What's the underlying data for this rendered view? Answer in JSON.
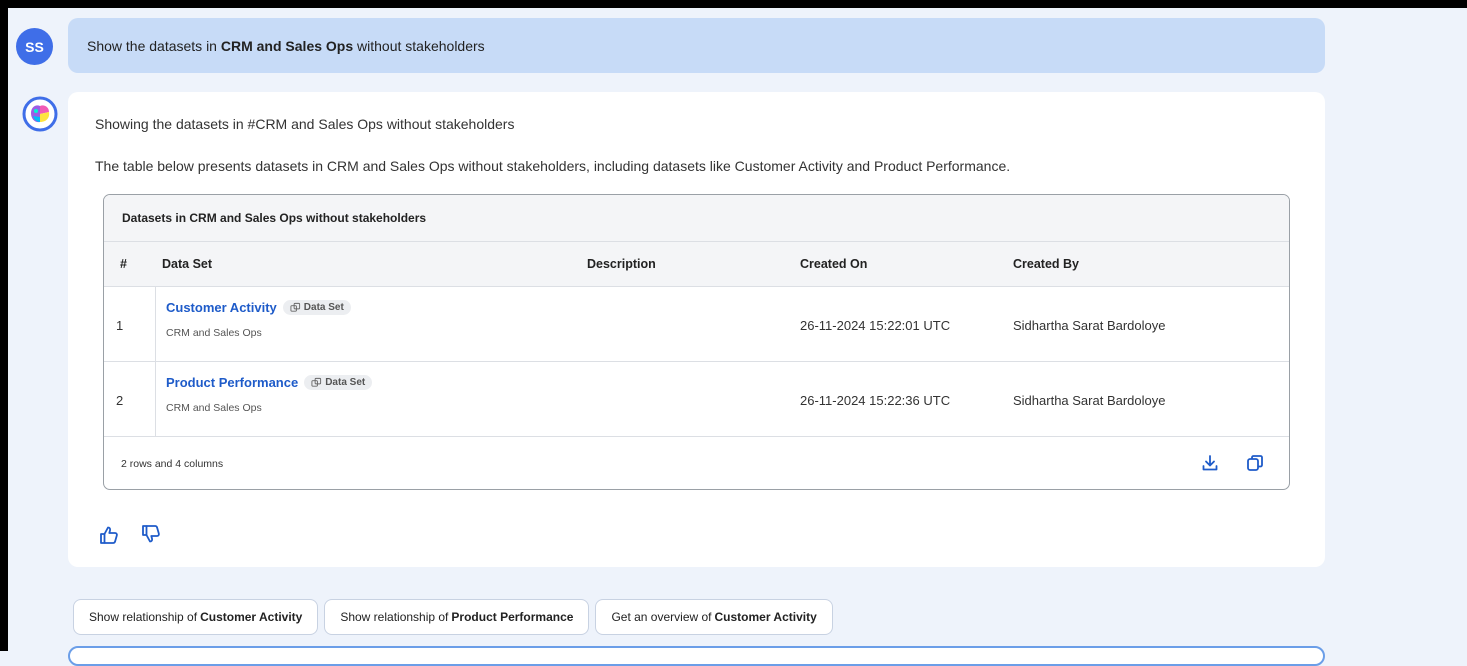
{
  "user": {
    "avatar_initials": "SS",
    "query_prefix": "Show the datasets in",
    "query_bold": "CRM and Sales Ops",
    "query_suffix": "without stakeholders"
  },
  "response": {
    "line1": "Showing the datasets in #CRM and Sales Ops without stakeholders",
    "line2": "The table below presents datasets in CRM and Sales Ops without stakeholders, including datasets like Customer Activity and Product Performance.",
    "table": {
      "title": "Datasets in CRM and Sales Ops without stakeholders",
      "headers": {
        "num": "#",
        "dataset": "Data Set",
        "description": "Description",
        "created_on": "Created On",
        "created_by": "Created By"
      },
      "rows": [
        {
          "num": "1",
          "name": "Customer Activity",
          "chip": "Data Set",
          "domain": "CRM and Sales Ops",
          "description": "",
          "created_on": "26-11-2024 15:22:01 UTC",
          "created_by": "Sidhartha Sarat Bardoloye"
        },
        {
          "num": "2",
          "name": "Product Performance",
          "chip": "Data Set",
          "domain": "CRM and Sales Ops",
          "description": "",
          "created_on": "26-11-2024 15:22:36 UTC",
          "created_by": "Sidhartha Sarat Bardoloye"
        }
      ],
      "summary": "2 rows and 4 columns"
    }
  },
  "suggestions": [
    {
      "prefix": "Show relationship of",
      "bold": "Customer Activity"
    },
    {
      "prefix": "Show relationship of",
      "bold": "Product Performance"
    },
    {
      "prefix": "Get an overview of",
      "bold": "Customer Activity"
    }
  ],
  "colors": {
    "accent": "#3f6ee8",
    "link": "#1e5bc9",
    "user_bubble": "#c7dbf7",
    "page_bg": "#eef3fb"
  },
  "icons": {
    "download": "download-icon",
    "copy": "copy-icon",
    "thumbs_up": "thumbs-up-icon",
    "thumbs_down": "thumbs-down-icon",
    "dataset_chip": "dataset-icon",
    "bot_avatar": "bot-avatar-icon"
  }
}
